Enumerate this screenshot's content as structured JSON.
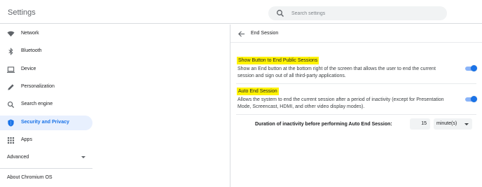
{
  "app": {
    "title": "Settings"
  },
  "search": {
    "placeholder": "Search settings",
    "icon": "search-icon"
  },
  "sidebar": {
    "items": [
      {
        "label": "Network",
        "icon": "wifi-icon"
      },
      {
        "label": "Bluetooth",
        "icon": "bluetooth-icon"
      },
      {
        "label": "Device",
        "icon": "laptop-icon"
      },
      {
        "label": "Personalization",
        "icon": "pencil-icon"
      },
      {
        "label": "Search engine",
        "icon": "search-icon"
      },
      {
        "label": "Security and Privacy",
        "icon": "shield-icon",
        "active": true
      },
      {
        "label": "Apps",
        "icon": "grid-icon"
      }
    ],
    "advanced": "Advanced",
    "about": "About Chromium OS"
  },
  "page": {
    "title": "End Session",
    "sections": [
      {
        "title": "Show Button to End Public Sessions",
        "description_line1": "Show an End button at the bottom right of the screen that allows the user to end the current",
        "description_line2": "session and sign out of all third-party applications.",
        "toggle_on": true
      },
      {
        "title": "Auto End Session",
        "description_line1": "Allows the system to end the current session after a period of inactivity (except for Presentation",
        "description_line2": "Mode, Screencast, HDMI, and other video display modes).",
        "toggle_on": true
      }
    ],
    "duration": {
      "label": "Duration of inactivity before performing Auto End Session:",
      "value": "15",
      "unit": "minute(s)"
    }
  },
  "colors": {
    "accent": "#1a73e8",
    "highlight": "#fff200",
    "active_bg": "#e8f0fe"
  }
}
